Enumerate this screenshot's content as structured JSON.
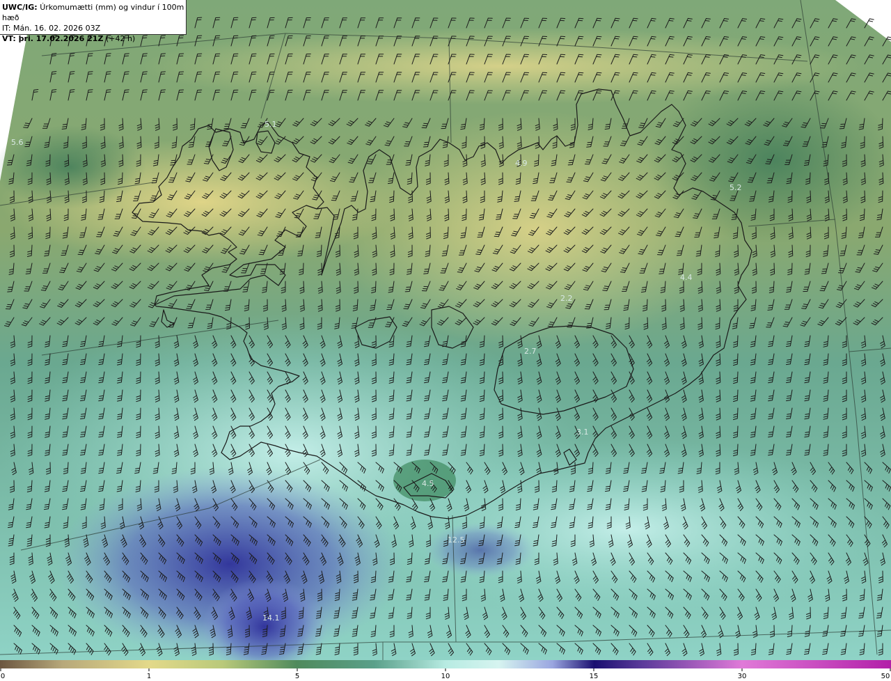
{
  "header": {
    "line1_prefix": "UWC/IG:",
    "line1_text": "Úrkomumætti (mm) og vindur í 100m hæð",
    "line2": "IT: Mán. 16. 02. 2026 03Z",
    "line3_prefix": "VT: þri. 17.02.2026 21Z",
    "line3_suffix": "(+42 h)"
  },
  "map_labels": [
    {
      "id": "lbl-5-6",
      "text": "5.6"
    },
    {
      "id": "lbl-5-1",
      "text": "5.1"
    },
    {
      "id": "lbl-4-9",
      "text": "4.9"
    },
    {
      "id": "lbl-5-2",
      "text": "5.2"
    },
    {
      "id": "lbl-4-4",
      "text": "4.4"
    },
    {
      "id": "lbl-2-2",
      "text": "2.2"
    },
    {
      "id": "lbl-2-7",
      "text": "2.7"
    },
    {
      "id": "lbl-3-1",
      "text": "3.1"
    },
    {
      "id": "lbl-4-5",
      "text": "4.5"
    },
    {
      "id": "lbl-12-5",
      "text": "12.5"
    },
    {
      "id": "lbl-14-1",
      "text": "14.1"
    }
  ],
  "colorbar": {
    "ticks": [
      "0",
      "1",
      "5",
      "10",
      "15",
      "30",
      "50"
    ],
    "colors": [
      "#6b5640",
      "#c9ba7a",
      "#e8de8c",
      "#a9c46f",
      "#4f8a5c",
      "#5fa88a",
      "#a7e3d8",
      "#d6f4f0",
      "#9aa6e0",
      "#3a3aa0",
      "#1a0f70",
      "#d68ad6",
      "#e86ae0",
      "#b21fa8"
    ]
  }
}
